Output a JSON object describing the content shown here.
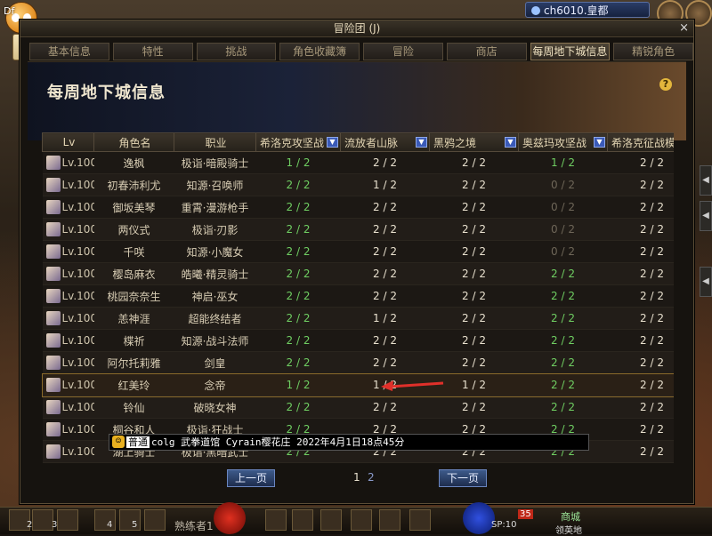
{
  "app": {
    "brand": "Df",
    "server": "ch6010.皇都"
  },
  "window": {
    "title": "冒险团 (J)",
    "close": "×"
  },
  "tabs": [
    "基本信息",
    "特性",
    "挑战",
    "角色收藏簿",
    "冒险",
    "商店",
    "每周地下城信息",
    "精锐角色"
  ],
  "active_tab_index": 6,
  "banner": {
    "title": "每周地下城信息",
    "help": "?"
  },
  "table": {
    "headers": [
      "Lv",
      "角色名",
      "职业",
      "希洛克攻坚战",
      "流放者山脉",
      "黑鸦之境",
      "奥兹玛攻坚战",
      "希洛克征战模式"
    ],
    "rows": [
      {
        "lv": "Lv.100",
        "name": "逸枫",
        "job": "极诣·暗殿骑士",
        "v": [
          {
            "t": "1 / 2",
            "c": "green"
          },
          {
            "t": "2 / 2",
            "c": "white"
          },
          {
            "t": "2 / 2",
            "c": "white"
          },
          {
            "t": "1 / 2",
            "c": "green"
          },
          {
            "t": "2 / 2",
            "c": "white"
          }
        ]
      },
      {
        "lv": "Lv.100",
        "name": "初春沛利尤",
        "job": "知源·召唤师",
        "v": [
          {
            "t": "2 / 2",
            "c": "green"
          },
          {
            "t": "1 / 2",
            "c": "white"
          },
          {
            "t": "2 / 2",
            "c": "white"
          },
          {
            "t": "0 / 2",
            "c": "gray"
          },
          {
            "t": "2 / 2",
            "c": "white"
          }
        ]
      },
      {
        "lv": "Lv.100",
        "name": "御坂美琴",
        "job": "重霄·漫游枪手",
        "v": [
          {
            "t": "2 / 2",
            "c": "green"
          },
          {
            "t": "2 / 2",
            "c": "white"
          },
          {
            "t": "2 / 2",
            "c": "white"
          },
          {
            "t": "0 / 2",
            "c": "gray"
          },
          {
            "t": "2 / 2",
            "c": "white"
          }
        ]
      },
      {
        "lv": "Lv.100",
        "name": "两仪式",
        "job": "极诣·刃影",
        "v": [
          {
            "t": "2 / 2",
            "c": "green"
          },
          {
            "t": "2 / 2",
            "c": "white"
          },
          {
            "t": "2 / 2",
            "c": "white"
          },
          {
            "t": "0 / 2",
            "c": "gray"
          },
          {
            "t": "2 / 2",
            "c": "white"
          }
        ]
      },
      {
        "lv": "Lv.100",
        "name": "千咲",
        "job": "知源·小魔女",
        "v": [
          {
            "t": "2 / 2",
            "c": "green"
          },
          {
            "t": "2 / 2",
            "c": "white"
          },
          {
            "t": "2 / 2",
            "c": "white"
          },
          {
            "t": "0 / 2",
            "c": "gray"
          },
          {
            "t": "2 / 2",
            "c": "white"
          }
        ]
      },
      {
        "lv": "Lv.100",
        "name": "樱岛麻衣",
        "job": "皓曦·精灵骑士",
        "v": [
          {
            "t": "2 / 2",
            "c": "green"
          },
          {
            "t": "2 / 2",
            "c": "white"
          },
          {
            "t": "2 / 2",
            "c": "white"
          },
          {
            "t": "2 / 2",
            "c": "green"
          },
          {
            "t": "2 / 2",
            "c": "white"
          }
        ]
      },
      {
        "lv": "Lv.100",
        "name": "桃园奈奈生",
        "job": "神启·巫女",
        "v": [
          {
            "t": "2 / 2",
            "c": "green"
          },
          {
            "t": "2 / 2",
            "c": "white"
          },
          {
            "t": "2 / 2",
            "c": "white"
          },
          {
            "t": "2 / 2",
            "c": "green"
          },
          {
            "t": "2 / 2",
            "c": "white"
          }
        ]
      },
      {
        "lv": "Lv.100",
        "name": "恙神涯",
        "job": "超能终结者",
        "v": [
          {
            "t": "2 / 2",
            "c": "green"
          },
          {
            "t": "1 / 2",
            "c": "white"
          },
          {
            "t": "2 / 2",
            "c": "white"
          },
          {
            "t": "2 / 2",
            "c": "green"
          },
          {
            "t": "2 / 2",
            "c": "white"
          }
        ]
      },
      {
        "lv": "Lv.100",
        "name": "楪祈",
        "job": "知源·战斗法师",
        "v": [
          {
            "t": "2 / 2",
            "c": "green"
          },
          {
            "t": "2 / 2",
            "c": "white"
          },
          {
            "t": "2 / 2",
            "c": "white"
          },
          {
            "t": "2 / 2",
            "c": "green"
          },
          {
            "t": "2 / 2",
            "c": "white"
          }
        ]
      },
      {
        "lv": "Lv.100",
        "name": "阿尔托莉雅",
        "job": "剑皇",
        "v": [
          {
            "t": "2 / 2",
            "c": "green"
          },
          {
            "t": "2 / 2",
            "c": "white"
          },
          {
            "t": "2 / 2",
            "c": "white"
          },
          {
            "t": "2 / 2",
            "c": "green"
          },
          {
            "t": "2 / 2",
            "c": "white"
          }
        ]
      },
      {
        "lv": "Lv.100",
        "name": "红美玲",
        "job": "念帝",
        "v": [
          {
            "t": "1 / 2",
            "c": "green"
          },
          {
            "t": "1 / 2",
            "c": "white"
          },
          {
            "t": "1 / 2",
            "c": "white"
          },
          {
            "t": "2 / 2",
            "c": "green"
          },
          {
            "t": "2 / 2",
            "c": "white"
          }
        ],
        "highlight": true
      },
      {
        "lv": "Lv.100",
        "name": "铃仙",
        "job": "破晓女神",
        "v": [
          {
            "t": "2 / 2",
            "c": "green"
          },
          {
            "t": "2 / 2",
            "c": "white"
          },
          {
            "t": "2 / 2",
            "c": "white"
          },
          {
            "t": "2 / 2",
            "c": "green"
          },
          {
            "t": "2 / 2",
            "c": "white"
          }
        ]
      },
      {
        "lv": "Lv.100",
        "name": "桐谷和人",
        "job": "极诣·狂战士",
        "v": [
          {
            "t": "2 / 2",
            "c": "green"
          },
          {
            "t": "2 / 2",
            "c": "white"
          },
          {
            "t": "2 / 2",
            "c": "white"
          },
          {
            "t": "2 / 2",
            "c": "green"
          },
          {
            "t": "2 / 2",
            "c": "white"
          }
        ]
      },
      {
        "lv": "Lv.100",
        "name": "湖上骑士",
        "job": "极诣·黑暗武士",
        "v": [
          {
            "t": "2 / 2",
            "c": "green"
          },
          {
            "t": "2 / 2",
            "c": "white"
          },
          {
            "t": "2 / 2",
            "c": "white"
          },
          {
            "t": "2 / 2",
            "c": "green"
          },
          {
            "t": "2 / 2",
            "c": "white"
          }
        ]
      }
    ]
  },
  "pager": {
    "prev": "上一页",
    "next": "下一页",
    "pages": [
      "1",
      "2"
    ],
    "current": "1"
  },
  "chat": {
    "icon": "☺",
    "channel": "普通",
    "message": "colg 武拳道馆 Cyrain樱花庄 2022年4月1日18点45分"
  },
  "hud": {
    "slot_labels": [
      "2",
      "3",
      "4",
      "5"
    ],
    "quickbar_name": "熟练者1",
    "level_badge": "35",
    "sp": "SP:10",
    "town_button": "商城",
    "town_label": "领英地"
  },
  "colors": {
    "completed_green": "#6fce62",
    "highlight_border": "#8a6a2a",
    "arrow_red": "#e0302a"
  }
}
